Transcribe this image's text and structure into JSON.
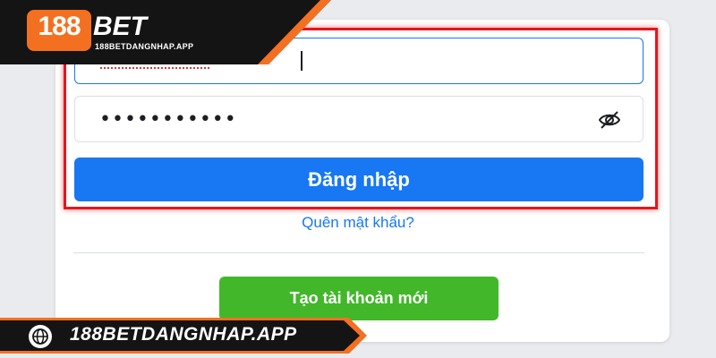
{
  "brand": {
    "logo_number": "188",
    "logo_word": "BET",
    "logo_subdomain": "188BETDANGNHAP.APP",
    "footer_domain": "188BETDANGNHAP.APP",
    "accent_orange": "#f37021",
    "banner_dark": "#141414"
  },
  "login_form": {
    "password_mask": "•••••••••••",
    "password_toggle_icon": "eye-slash-icon",
    "login_button_label": "Đăng nhập",
    "forgot_password_link": "Quên mật khẩu?",
    "create_account_button_label": "Tạo tài khoản mới",
    "primary_color": "#1877f2",
    "create_color": "#42b72a",
    "highlight_color": "#e8141b"
  }
}
